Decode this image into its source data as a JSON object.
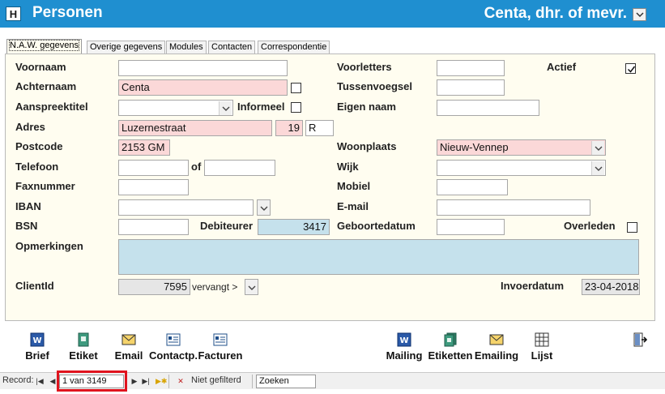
{
  "window": {
    "title": "Personen",
    "title_icon": "H",
    "record_name": "Centa, dhr. of mevr."
  },
  "tabs": [
    {
      "label": "N.A.W. gegevens",
      "active": true
    },
    {
      "label": "Overige gegevens",
      "active": false
    },
    {
      "label": "Modules",
      "active": false
    },
    {
      "label": "Contacten",
      "active": false
    },
    {
      "label": "Correspondentie",
      "active": false
    }
  ],
  "form": {
    "voornaam": {
      "label": "Voornaam",
      "value": ""
    },
    "achternaam": {
      "label": "Achternaam",
      "value": "Centa"
    },
    "aanspreektitel": {
      "label": "Aanspreektitel",
      "value": ""
    },
    "informeel": {
      "label": "Informeel",
      "checked": false
    },
    "adres": {
      "label": "Adres",
      "straat": "Luzernestraat",
      "huisnummer": "19",
      "toevoeging": "R"
    },
    "postcode": {
      "label": "Postcode",
      "value": "2153 GM"
    },
    "telefoon": {
      "label": "Telefoon",
      "value": "",
      "of_label": "of",
      "value2": ""
    },
    "faxnummer": {
      "label": "Faxnummer",
      "value": ""
    },
    "iban": {
      "label": "IBAN",
      "value": ""
    },
    "bsn": {
      "label": "BSN",
      "value": ""
    },
    "debiteur": {
      "label": "Debiteurer",
      "value": "3417"
    },
    "opmerkingen": {
      "label": "Opmerkingen",
      "value": ""
    },
    "clientid": {
      "label": "ClientId",
      "value": "7595",
      "vervangt_label": "vervangt >"
    },
    "voorletters": {
      "label": "Voorletters",
      "value": ""
    },
    "tussenvoegsel": {
      "label": "Tussenvoegsel",
      "value": ""
    },
    "eigen_naam": {
      "label": "Eigen naam",
      "value": ""
    },
    "woonplaats": {
      "label": "Woonplaats",
      "value": "Nieuw-Vennep"
    },
    "wijk": {
      "label": "Wijk",
      "value": ""
    },
    "mobiel": {
      "label": "Mobiel",
      "value": ""
    },
    "email": {
      "label": "E-mail",
      "value": ""
    },
    "geboortedatum": {
      "label": "Geboortedatum",
      "value": ""
    },
    "actief": {
      "label": "Actief",
      "checked": true
    },
    "overleden": {
      "label": "Overleden",
      "checked": false
    },
    "invoerdatum": {
      "label": "Invoerdatum",
      "value": "23-04-2018"
    }
  },
  "toolbar": {
    "brief": "Brief",
    "etiket": "Etiket",
    "email": "Email",
    "contactp": "Contactp.",
    "facturen": "Facturen",
    "mailing": "Mailing",
    "etiketten": "Etiketten",
    "emailing": "Emailing",
    "lijst": "Lijst"
  },
  "navigation": {
    "record_label": "Record:",
    "position": "1 van 3149",
    "filter_status": "Niet gefilterd",
    "search_placeholder": "Zoeken"
  },
  "colors": {
    "header": "#1f8fd0",
    "panel": "#fffdf0",
    "required_field": "#fbd8d8",
    "info_field": "#c5e1ec",
    "highlight": "#e0141e"
  }
}
